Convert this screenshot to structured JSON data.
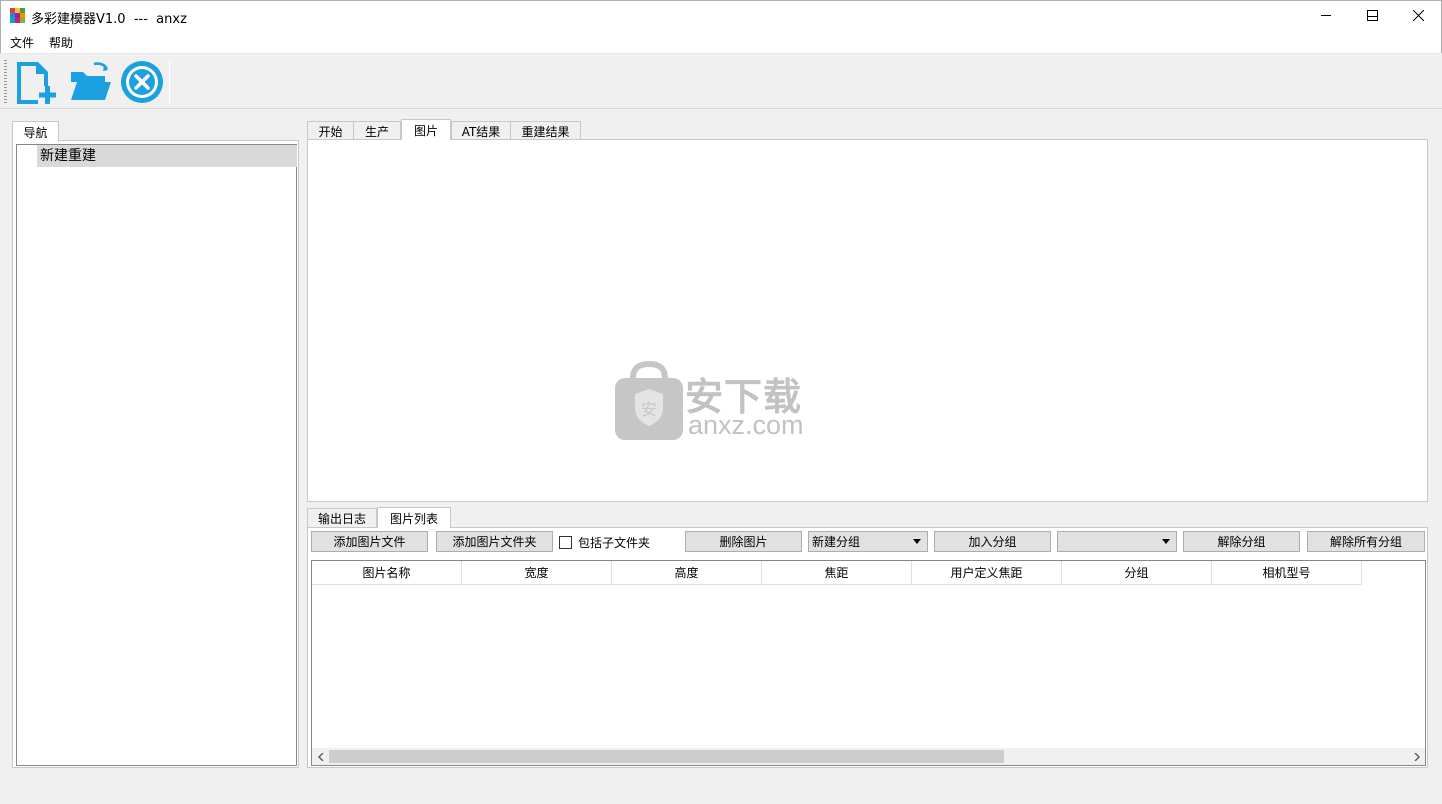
{
  "window": {
    "title": "多彩建模器V1.0  ---  anxz",
    "controls": [
      "minimize-icon",
      "maximize-icon",
      "close-icon"
    ]
  },
  "menu": [
    "文件",
    "帮助"
  ],
  "toolbar": {
    "buttons": [
      {
        "icon": "new-document-icon",
        "color": "#1ba1e2"
      },
      {
        "icon": "open-folder-icon",
        "color": "#1ba1e2"
      },
      {
        "icon": "close-circle-icon",
        "color": "#1ba1e2"
      }
    ]
  },
  "navigation": {
    "tab": "导航",
    "items": [
      "新建重建"
    ]
  },
  "main_tabs": {
    "labels": [
      "开始",
      "生产",
      "图片",
      "AT结果",
      "重建结果"
    ],
    "active": "图片"
  },
  "watermark": {
    "text": "安下载",
    "domain": "anxz.com"
  },
  "bottom_tabs": {
    "labels": [
      "输出日志",
      "图片列表"
    ],
    "active": "图片列表"
  },
  "image_list": {
    "add_image_label": "添加图片文件",
    "add_folder_label": "添加图片文件夹",
    "include_subfolder_label": "包括子文件夹",
    "include_subfolder_checked": false,
    "delete_label": "删除图片",
    "new_group_select": "新建分组",
    "join_group_label": "加入分组",
    "group_select": "",
    "ungroup_label": "解除分组",
    "ungroup_all_label": "解除所有分组",
    "columns": [
      "图片名称",
      "宽度",
      "高度",
      "焦距",
      "用户定义焦距",
      "分组",
      "相机型号"
    ],
    "rows": []
  }
}
